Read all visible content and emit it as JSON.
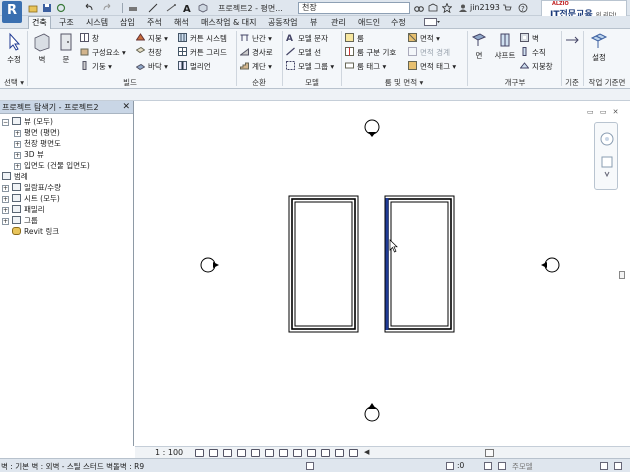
{
  "titlebar": {
    "app_letter": "R",
    "document_title": "프로젝트2 - 평면...",
    "search_value": "천장",
    "user_name": "jin2193",
    "brand_small": "ALZIO",
    "brand_main": "IT전문교육",
    "brand_tail": "의 리더!"
  },
  "tabs": [
    {
      "label": "건축",
      "active": true
    },
    {
      "label": "구조"
    },
    {
      "label": "시스템"
    },
    {
      "label": "삽입"
    },
    {
      "label": "주석"
    },
    {
      "label": "해석"
    },
    {
      "label": "매스작업 & 대지"
    },
    {
      "label": "공동작업"
    },
    {
      "label": "뷰"
    },
    {
      "label": "관리"
    },
    {
      "label": "애드인"
    },
    {
      "label": "수정"
    }
  ],
  "ribbon": {
    "select": {
      "button": "수정",
      "group": "선택 ▾"
    },
    "build": {
      "wall": "벽",
      "door": "문",
      "window": "창",
      "component": "구성요소 ▾",
      "column": "기둥 ▾",
      "roof": "지붕 ▾",
      "ceiling": "천장",
      "floor": "바닥 ▾",
      "curtain_system": "커튼 시스템",
      "curtain_grid": "커튼 그리드",
      "mullion": "멀리언",
      "group": "빌드"
    },
    "circulation": {
      "railing": "난간 ▾",
      "ramp": "경사로",
      "stair": "계단 ▾",
      "group": "순환"
    },
    "model": {
      "model_text": "모델 문자",
      "model_line": "모델 선",
      "model_group": "모델 그룹 ▾",
      "group": "모델"
    },
    "room_area": {
      "room": "룸",
      "room_separator": "룸 구분 기호",
      "tag_room": "룸 태그 ▾",
      "area": "면적 ▾",
      "area_boundary": "면적 경계",
      "tag_area": "면적 태그 ▾",
      "group": "룸 및 면적 ▾"
    },
    "opening": {
      "face": "면",
      "shaft": "샤프트",
      "wall": "벽",
      "vertical": "수직",
      "dormer": "지붕창",
      "group": "개구부"
    },
    "datum": {
      "group": "기준"
    },
    "work_plane": {
      "set": "설정",
      "group": "작업 기준면"
    }
  },
  "project_browser": {
    "title": "프로젝트 탐색기 - 프로젝트2",
    "tree": [
      {
        "label": "뷰 (모두)",
        "level": 0,
        "expander": "−"
      },
      {
        "label": "평면 (평면)",
        "level": 1,
        "expander": "+"
      },
      {
        "label": "천장 평면도",
        "level": 1,
        "expander": "+"
      },
      {
        "label": "3D 뷰",
        "level": 1,
        "expander": "+"
      },
      {
        "label": "입면도 (건물 입면도)",
        "level": 1,
        "expander": "+"
      },
      {
        "label": "범례",
        "level": 0,
        "expander": ""
      },
      {
        "label": "일람표/수량",
        "level": 0,
        "expander": ""
      },
      {
        "label": "시트 (모두)",
        "level": 0,
        "expander": ""
      },
      {
        "label": "패밀리",
        "level": 0,
        "expander": "+"
      },
      {
        "label": "그룹",
        "level": 0,
        "expander": "+"
      },
      {
        "label": "Revit 링크",
        "level": 0,
        "expander": ""
      }
    ]
  },
  "view_bar": {
    "scale": "1 : 100"
  },
  "status_bar": {
    "text": "벽 : 기본 벽 : 외벽 - 스틸 스터드 벽돌벽 : R9",
    "selection_count": ":0",
    "model_label": "주모델"
  },
  "colors": {
    "selected_wall": "#1f3a93",
    "ribbon_bg": "#f4f7fa",
    "header_bg": "#dfe6ee"
  }
}
